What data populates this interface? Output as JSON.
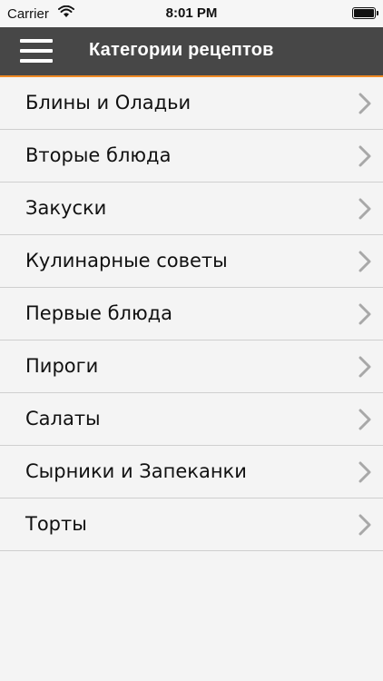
{
  "status_bar": {
    "carrier": "Carrier",
    "time": "8:01 PM"
  },
  "navbar": {
    "title": "Категории рецептов",
    "accent_color": "#f08a24",
    "background_color": "#474747"
  },
  "categories": [
    {
      "label": "Блины и Оладьи"
    },
    {
      "label": "Вторые блюда"
    },
    {
      "label": "Закуски"
    },
    {
      "label": "Кулинарные советы"
    },
    {
      "label": "Первые блюда"
    },
    {
      "label": "Пироги"
    },
    {
      "label": "Салаты"
    },
    {
      "label": "Сырники и Запеканки"
    },
    {
      "label": "Торты"
    }
  ],
  "icons": {
    "menu": "hamburger-menu-icon",
    "row": "chevron-right-icon",
    "wifi": "wifi-icon",
    "battery": "battery-icon"
  }
}
